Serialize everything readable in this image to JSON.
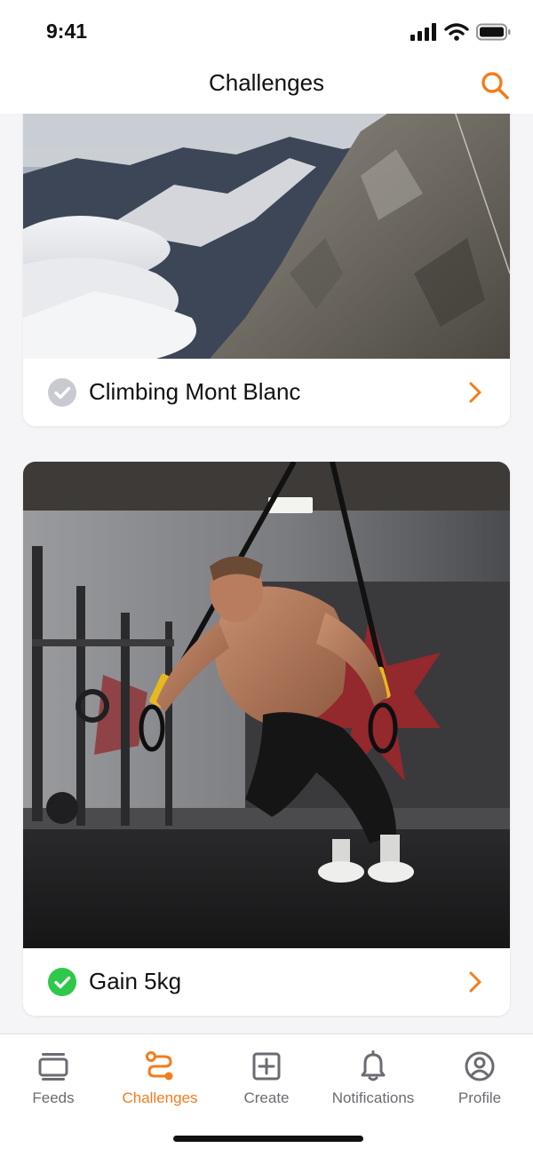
{
  "status_bar": {
    "time": "9:41",
    "icons": [
      "cellular-signal-icon",
      "wifi-icon",
      "battery-icon"
    ]
  },
  "header": {
    "title": "Challenges",
    "search_icon": "search-icon"
  },
  "challenges": [
    {
      "title": "Climbing Mont Blanc",
      "status": "incomplete",
      "status_color": "#c9c9d1",
      "image": "mountain-ridge-photo"
    },
    {
      "title": "Gain 5kg",
      "status": "completed",
      "status_color": "#2fc84b",
      "image": "gym-suspension-training-photo"
    }
  ],
  "tabs": [
    {
      "label": "Feeds",
      "icon": "feeds-icon",
      "active": false
    },
    {
      "label": "Challenges",
      "icon": "challenges-route-icon",
      "active": true
    },
    {
      "label": "Create",
      "icon": "create-plus-icon",
      "active": false
    },
    {
      "label": "Notifications",
      "icon": "bell-icon",
      "active": false
    },
    {
      "label": "Profile",
      "icon": "profile-icon",
      "active": false
    }
  ],
  "colors": {
    "accent": "#f47c1d",
    "text": "#111111",
    "muted": "#6b6b72",
    "background": "#f5f5f7",
    "success": "#2fc84b"
  }
}
